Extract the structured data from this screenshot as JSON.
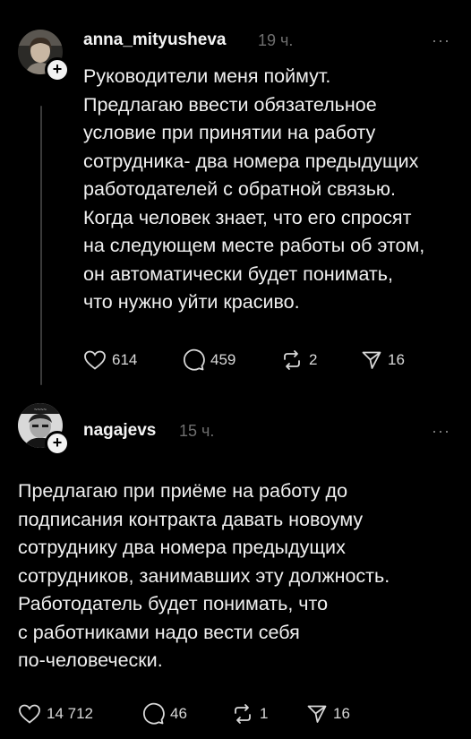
{
  "posts": [
    {
      "username": "anna_mityusheva",
      "time": "19 ч.",
      "more": "···",
      "text": "Руководители меня поймут.\nПредлагаю ввести обязательное\nусловие при принятии на работу\nсотрудника- два номера предыдущих\nработодателей с обратной связью.\nКогда человек знает, что его спросят\nна следующем месте работы об этом,\nон автоматически будет понимать,\nчто нужно уйти красиво.",
      "likes": "614",
      "comments": "459",
      "reposts": "2",
      "shares": "16"
    },
    {
      "username": "nagajevs",
      "time": "15 ч.",
      "more": "···",
      "text": "Предлагаю при приёме на работу до\nподписания контракта давать новоуму\nсотруднику два номера предыдущих\nсотрудников, занимавших эту должность.\nРаботодатель будет понимать, что\nс работниками надо вести себя\nпо-человечески.",
      "likes": "14 712",
      "comments": "46",
      "reposts": "1",
      "shares": "16"
    }
  ],
  "icons": {
    "like": "heart-icon",
    "comment": "comment-bubble-icon",
    "repost": "repost-icon",
    "share": "send-icon",
    "follow": "plus-icon",
    "more": "ellipsis-icon"
  },
  "colors": {
    "background": "#000000",
    "text": "#f0f0f0",
    "muted": "#6f6f6f",
    "thread_line": "#3a3a3a"
  }
}
